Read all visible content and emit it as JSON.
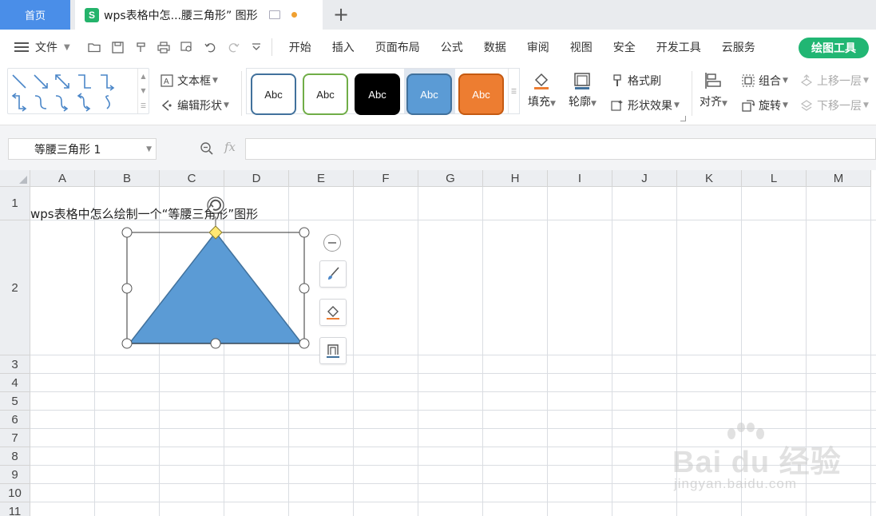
{
  "tabs": {
    "home": "首页",
    "document_title": "wps表格中怎...腰三角形” 图形"
  },
  "menu": {
    "file": "文件",
    "items": [
      "开始",
      "插入",
      "页面布局",
      "公式",
      "数据",
      "审阅",
      "视图",
      "安全",
      "开发工具",
      "云服务"
    ],
    "drawing_tools": "绘图工具"
  },
  "ribbon": {
    "text_box": "文本框",
    "edit_shape": "编辑形状",
    "style_samples": [
      "Abc",
      "Abc",
      "Abc",
      "Abc",
      "Abc"
    ],
    "fill": "填充",
    "outline": "轮廓",
    "format_painter": "格式刷",
    "shape_effects": "形状效果",
    "align": "对齐",
    "group": "组合",
    "rotate": "旋转",
    "bring_forward": "上移一层",
    "send_backward": "下移一层"
  },
  "formula_bar": {
    "name_box": "等腰三角形 1",
    "fx": "fx",
    "formula": ""
  },
  "sheet": {
    "columns": [
      "A",
      "B",
      "C",
      "D",
      "E",
      "F",
      "G",
      "H",
      "I",
      "J",
      "K",
      "L",
      "M"
    ],
    "rows": [
      "1",
      "2",
      "3",
      "4",
      "5",
      "6",
      "7",
      "8",
      "9",
      "10",
      "11"
    ],
    "cell_a1": "wps表格中怎么绘制一个“等腰三角形”图形"
  },
  "watermark": {
    "brand": "Bai du 经验",
    "url": "jingyan.baidu.com"
  },
  "colors": {
    "home_tab": "#4a8ee8",
    "accent_green": "#21b673",
    "shape_fill": "#5b9bd5",
    "shape_stroke": "#41719c",
    "style_orange": "#ed7d31"
  }
}
